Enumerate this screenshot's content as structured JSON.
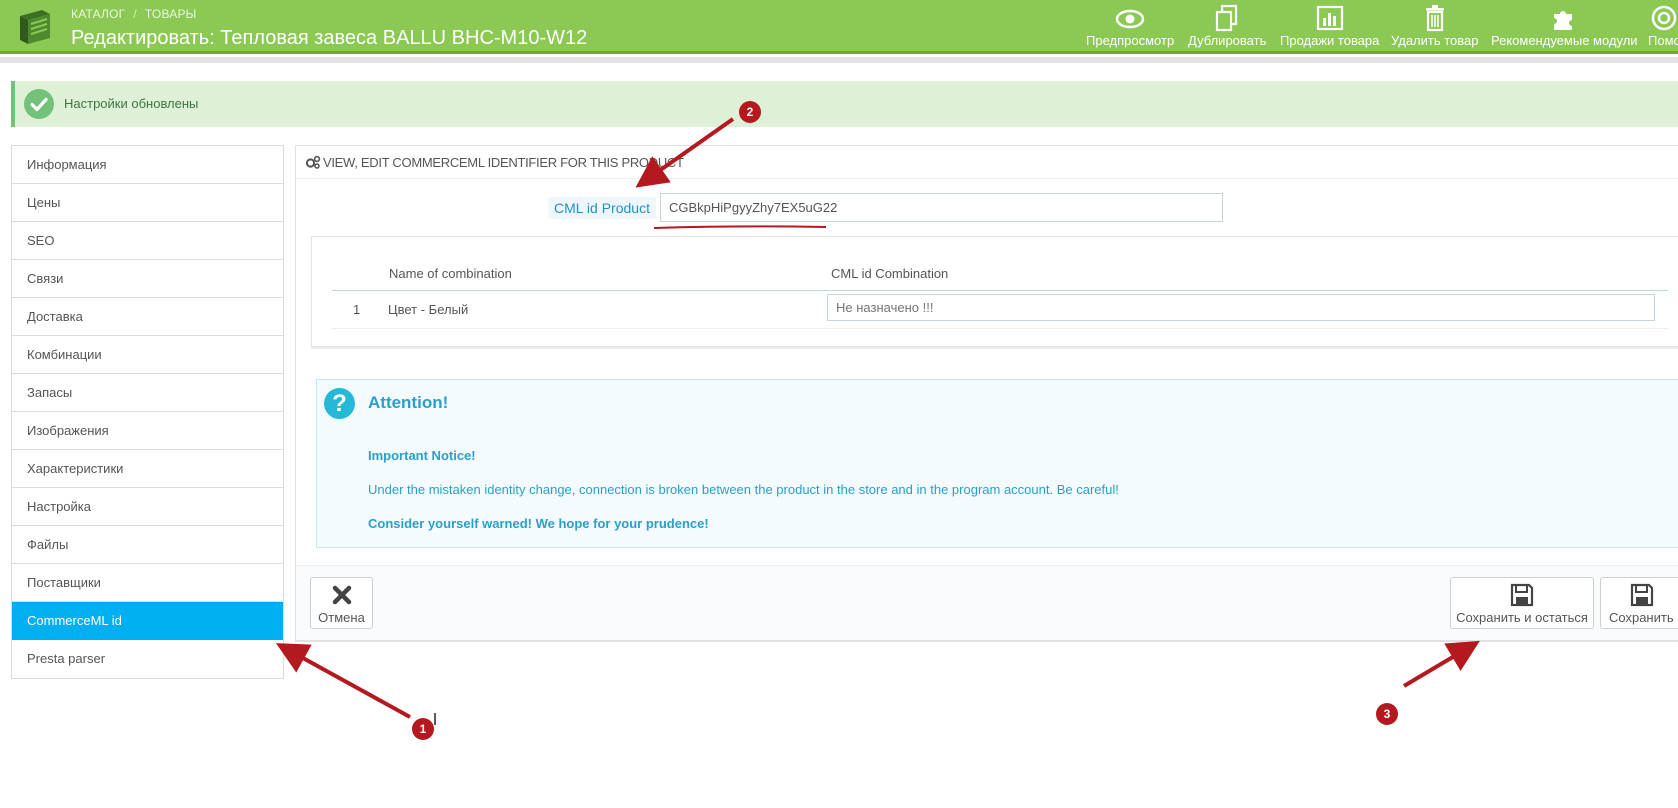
{
  "header": {
    "breadcrumb": [
      "КАТАЛОГ",
      "ТОВАРЫ"
    ],
    "breadcrumb_separator": "/",
    "title": "Редактировать: Тепловая завеса BALLU BHC-M10-W12",
    "toolbar": [
      {
        "label": "Предпросмотр",
        "icon": "eye-icon"
      },
      {
        "label": "Дублировать",
        "icon": "duplicate-icon"
      },
      {
        "label": "Продажи товара",
        "icon": "bar-chart-icon"
      },
      {
        "label": "Удалить товар",
        "icon": "trash-icon"
      },
      {
        "label": "Рекомендуемые модули",
        "icon": "puzzle-icon"
      },
      {
        "label": "Помо",
        "icon": "help-icon"
      }
    ]
  },
  "alert": {
    "message": "Настройки обновлены",
    "status_color": "#72c279"
  },
  "sidebar": {
    "items": [
      {
        "label": "Информация"
      },
      {
        "label": "Цены"
      },
      {
        "label": "SEO"
      },
      {
        "label": "Связи"
      },
      {
        "label": "Доставка"
      },
      {
        "label": "Комбинации"
      },
      {
        "label": "Запасы"
      },
      {
        "label": "Изображения"
      },
      {
        "label": "Характеристики"
      },
      {
        "label": "Настройка"
      },
      {
        "label": "Файлы"
      },
      {
        "label": "Поставщики"
      },
      {
        "label": "CommerceML id",
        "active": true
      },
      {
        "label": "Presta parser"
      }
    ]
  },
  "panel": {
    "heading": "VIEW, EDIT COMMERCEML IDENTIFIER FOR THIS PRODUCT",
    "product_label": "CML id Product",
    "product_value": "CGBkpHiPgyyZhy7EX5uG22",
    "combinations": {
      "columns": [
        "Name of combination",
        "CML id Combination"
      ],
      "rows": [
        {
          "index": "1",
          "name": "Цвет - Белый",
          "cml_id": "",
          "placeholder": "Не назначено !!!"
        }
      ]
    },
    "notice": {
      "title": "Attention!",
      "important": "Important Notice!",
      "body": "Under the mistaken identity change, connection is broken between the product in the store and in the program account. Be careful!",
      "warning": "Consider yourself warned! We hope for your prudence!"
    },
    "footer": {
      "cancel_label": "Отмена",
      "save_stay_label": "Сохранить и остаться",
      "save_label": "Сохранить"
    }
  },
  "annotations": {
    "badges": [
      "1",
      "2",
      "3"
    ],
    "color": "#b3191f"
  },
  "colors": {
    "header_green": "#8bc954",
    "active_blue": "#00aff0",
    "notice_blue": "#2a9fc9"
  }
}
